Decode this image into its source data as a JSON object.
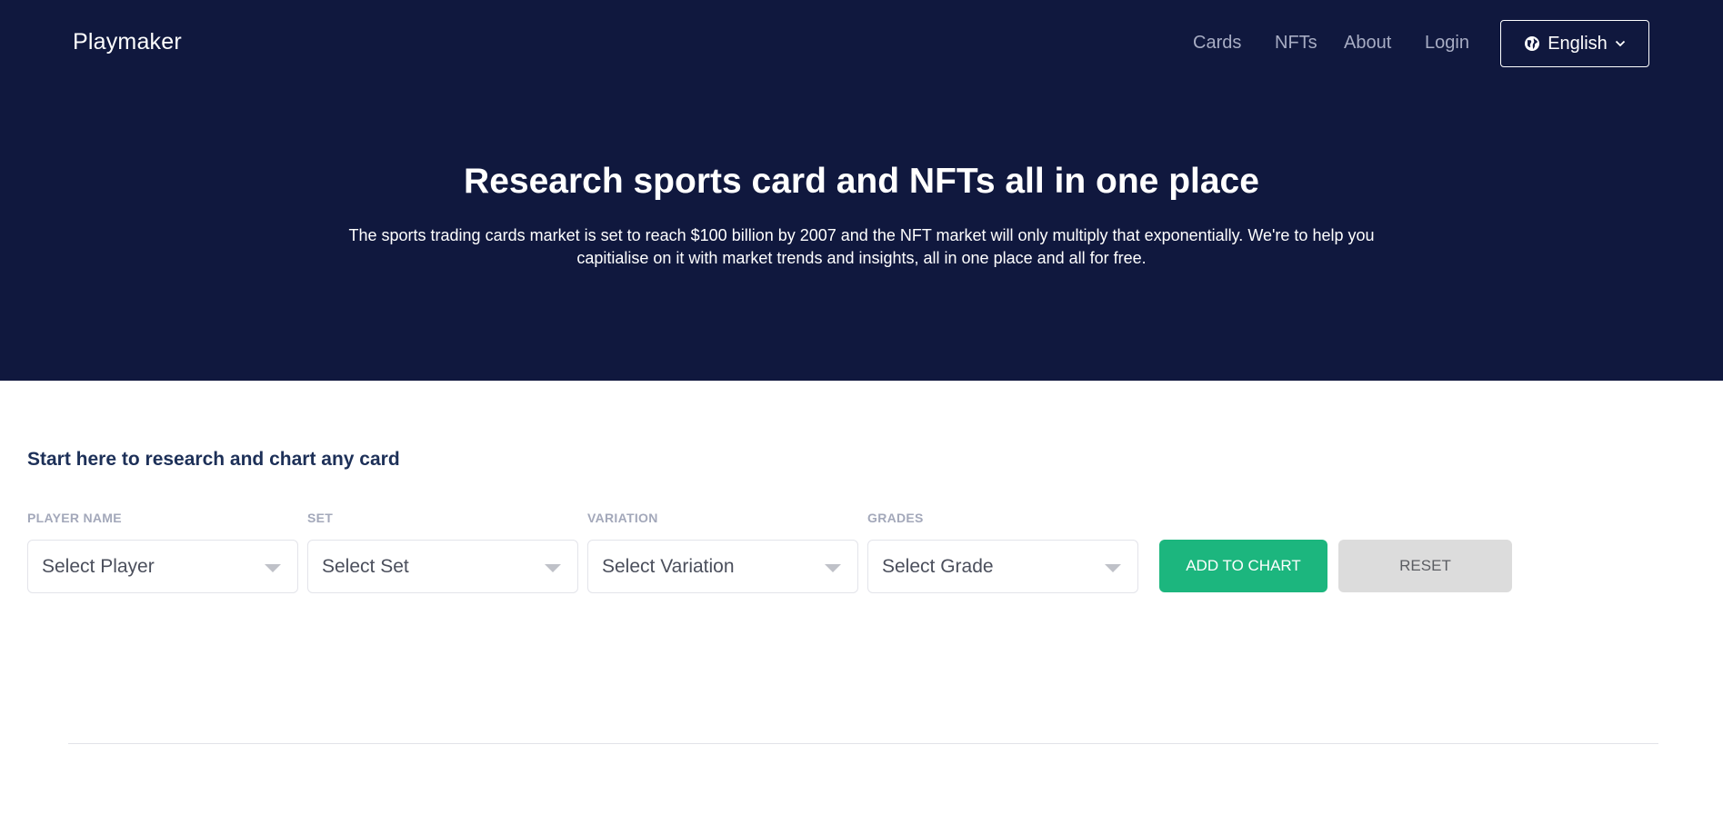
{
  "header": {
    "brand": "Playmaker",
    "nav": [
      "Cards",
      "NFTs",
      "About",
      "Login"
    ],
    "language": "English"
  },
  "hero": {
    "title": "Research sports card and NFTs all in one place",
    "subtitle": "The sports trading cards market is set to reach $100 billion by 2007 and the NFT market will only multiply that exponentially. We're to help you capitialise on it with market trends and insights, all in one place and all for free."
  },
  "research": {
    "title": "Start here to research and chart any card",
    "fields": [
      {
        "label": "PLAYER NAME",
        "placeholder": "Select Player"
      },
      {
        "label": "SET",
        "placeholder": "Select Set"
      },
      {
        "label": "VARIATION",
        "placeholder": "Select Variation"
      },
      {
        "label": "GRADES",
        "placeholder": "Select Grade"
      }
    ],
    "add_label": "ADD TO CHART",
    "reset_label": "RESET"
  },
  "colors": {
    "hero_bg": "#10183e",
    "accent_green": "#1cb67e",
    "reset_bg": "#dcdcdc",
    "heading_blue": "#1d3058"
  }
}
